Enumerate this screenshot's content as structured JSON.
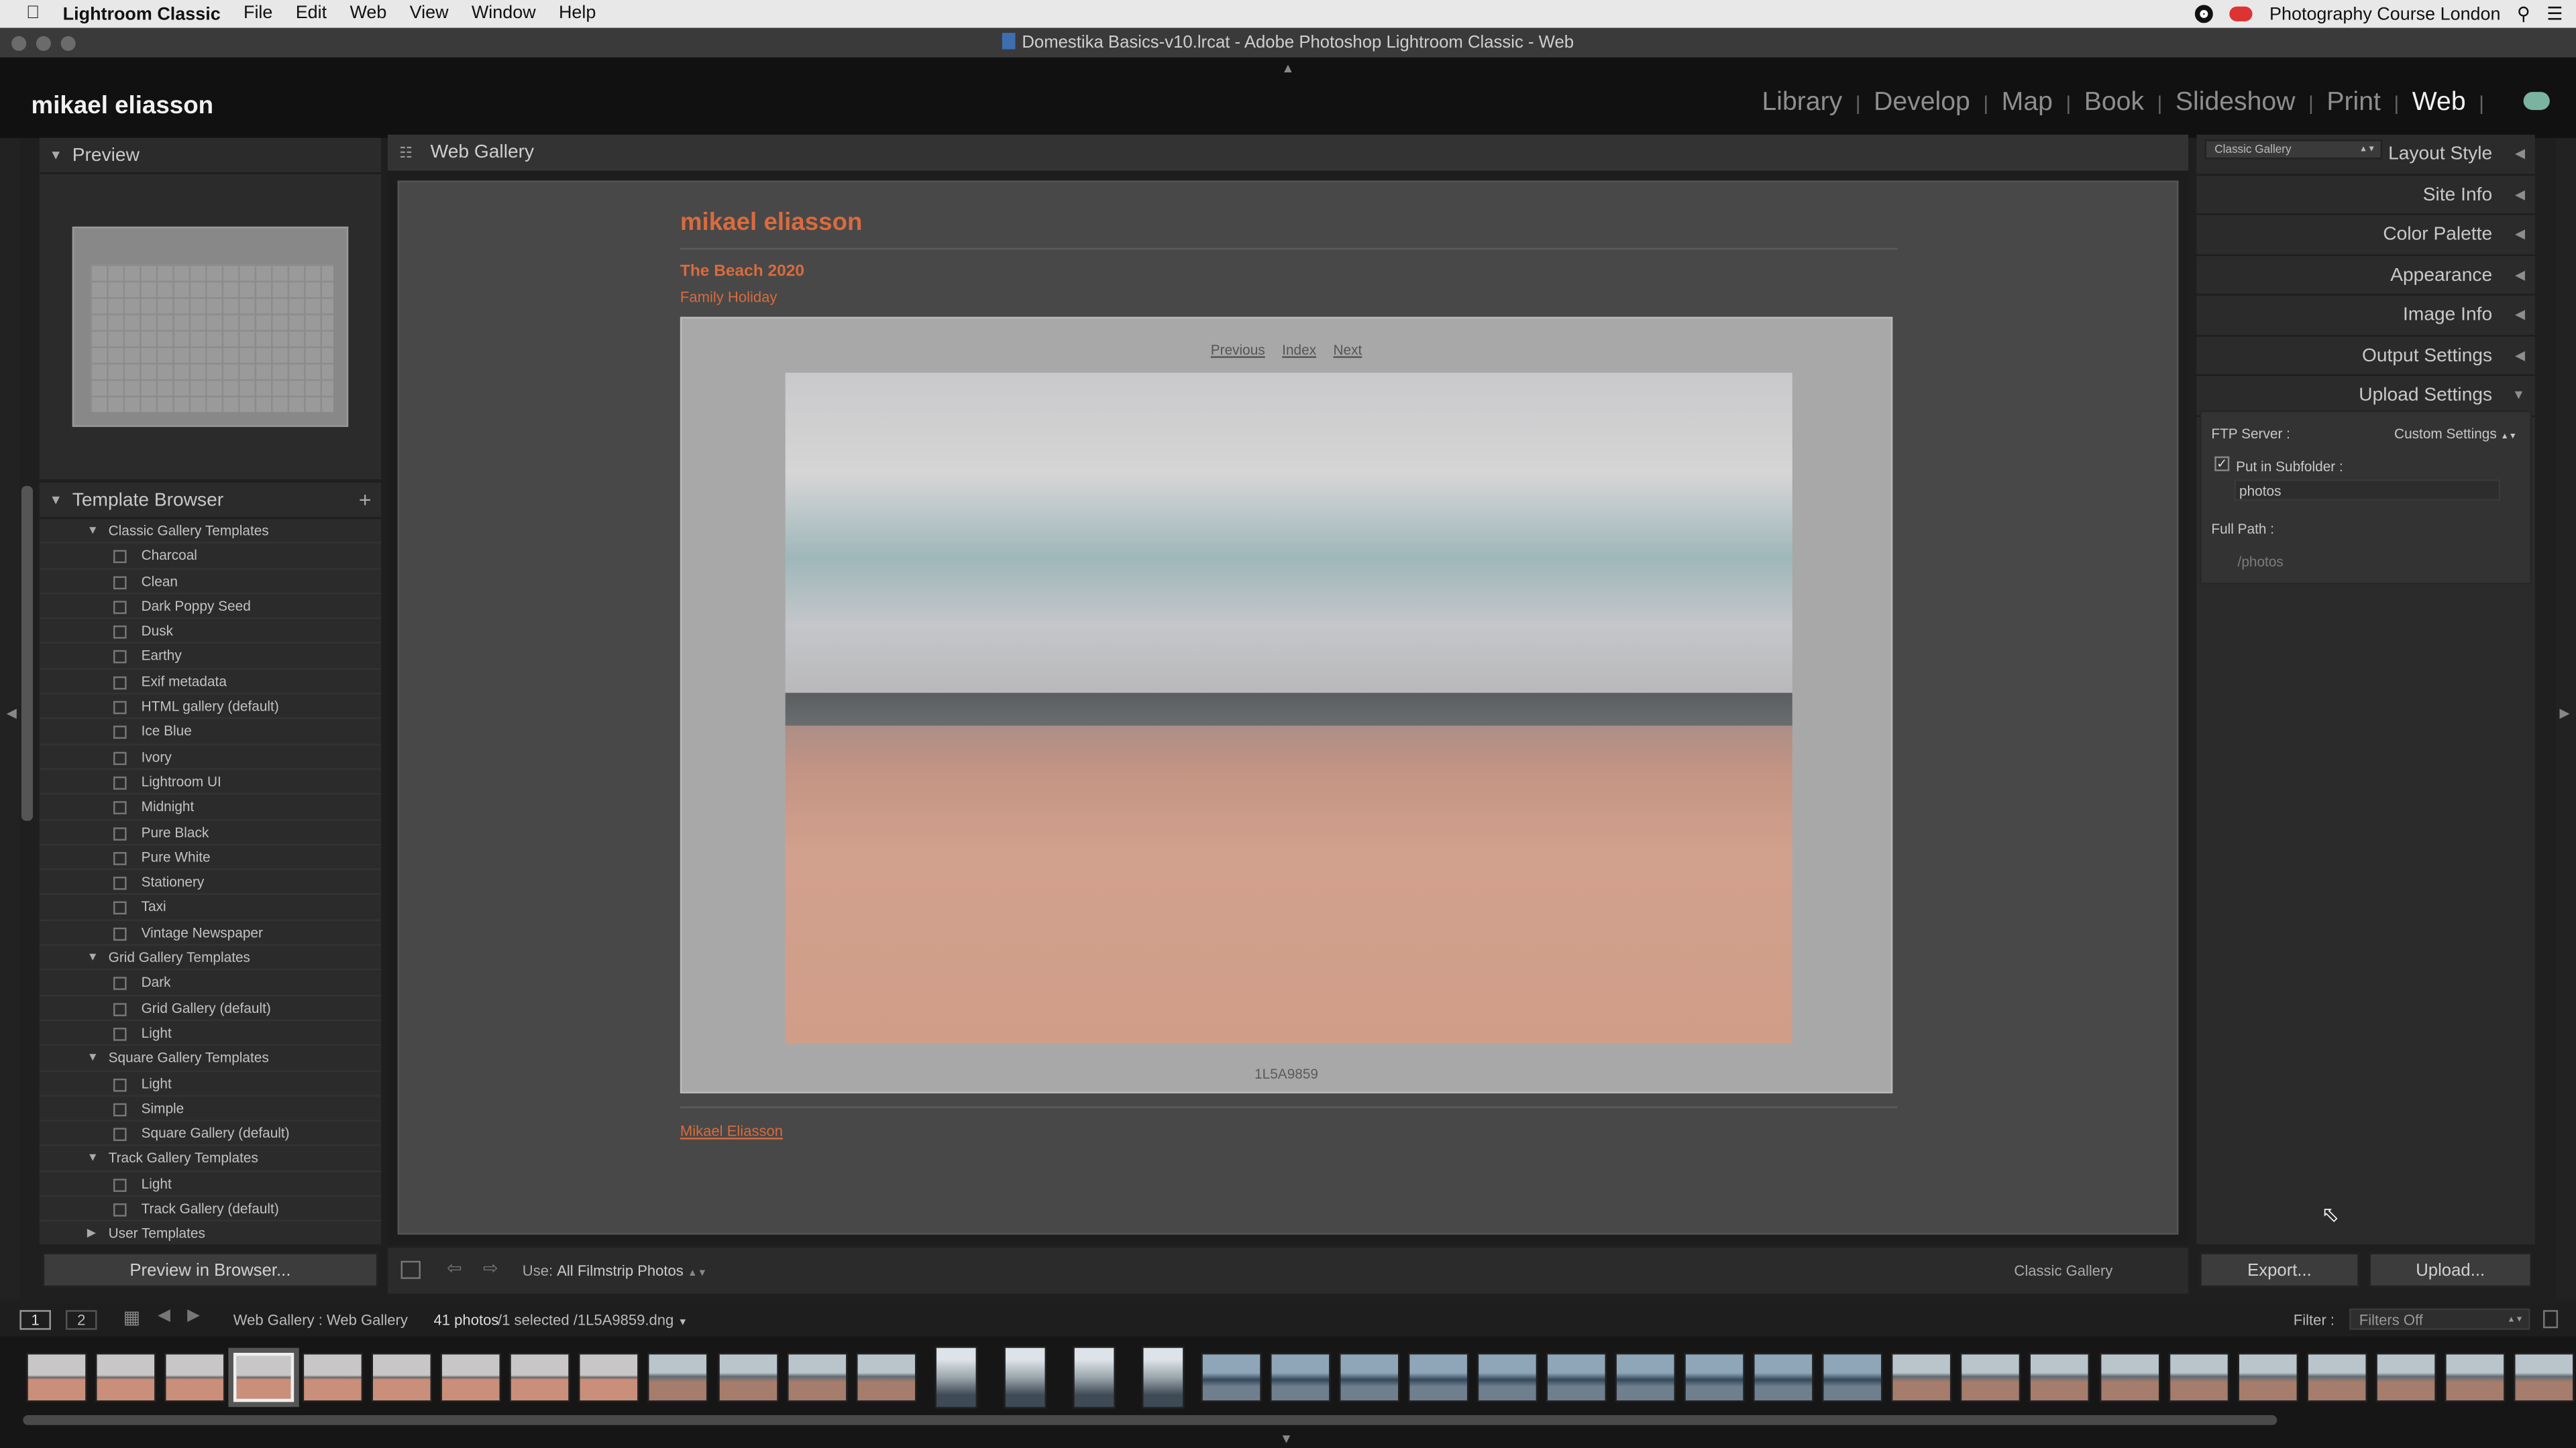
{
  "menubar": {
    "app": "Lightroom Classic",
    "items": [
      "File",
      "Edit",
      "Web",
      "View",
      "Window",
      "Help"
    ],
    "right_title": "Photography Course London"
  },
  "window": {
    "title": "Domestika Basics-v10.lrcat - Adobe Photoshop Lightroom Classic - Web"
  },
  "identity_plate": "mikael eliasson",
  "modules": [
    "Library",
    "Develop",
    "Map",
    "Book",
    "Slideshow",
    "Print",
    "Web"
  ],
  "active_module": "Web",
  "left_panel": {
    "preview_label": "Preview",
    "template_browser_label": "Template Browser",
    "groups": [
      {
        "name": "Classic Gallery Templates",
        "items": [
          "Charcoal",
          "Clean",
          "Dark Poppy Seed",
          "Dusk",
          "Earthy",
          "Exif metadata",
          "HTML gallery (default)",
          "Ice Blue",
          "Ivory",
          "Lightroom UI",
          "Midnight",
          "Pure Black",
          "Pure White",
          "Stationery",
          "Taxi",
          "Vintage Newspaper"
        ]
      },
      {
        "name": "Grid Gallery Templates",
        "items": [
          "Dark",
          "Grid Gallery (default)",
          "Light"
        ]
      },
      {
        "name": "Square Gallery Templates",
        "items": [
          "Light",
          "Simple",
          "Square Gallery (default)"
        ]
      },
      {
        "name": "Track Gallery Templates",
        "items": [
          "Light",
          "Track Gallery (default)"
        ]
      },
      {
        "name": "User Templates",
        "items": []
      }
    ],
    "preview_in_browser": "Preview in Browser..."
  },
  "center": {
    "header": "Web Gallery",
    "site_title": "mikael eliasson",
    "collection_title": "The Beach 2020",
    "collection_desc": "Family Holiday",
    "nav": {
      "previous": "Previous",
      "index": "Index",
      "next": "Next"
    },
    "caption": "1L5A9859",
    "contact": "Mikael Eliasson",
    "toolbar": {
      "use_label": "Use:",
      "use_value": "All Filmstrip Photos",
      "gallery_name": "Classic Gallery"
    }
  },
  "right_panel": {
    "layout_select": "Classic Gallery",
    "sections": [
      "Layout Style",
      "Site Info",
      "Color Palette",
      "Appearance",
      "Image Info",
      "Output Settings",
      "Upload Settings"
    ],
    "ftp_label": "FTP Server :",
    "ftp_value": "Custom Settings",
    "subfolder_label": "Put in Subfolder :",
    "subfolder_checked": true,
    "subfolder_value": "photos",
    "full_path_label": "Full Path :",
    "full_path_value": "/photos",
    "export_button": "Export...",
    "upload_button": "Upload..."
  },
  "filmstrip": {
    "screen1": "1",
    "screen2": "2",
    "breadcrumb": "Web Gallery : Web Gallery",
    "count": "41 photos",
    "selection": "/1 selected /1L5A9859.dng",
    "filter_label": "Filter :",
    "filter_value": "Filters Off"
  }
}
